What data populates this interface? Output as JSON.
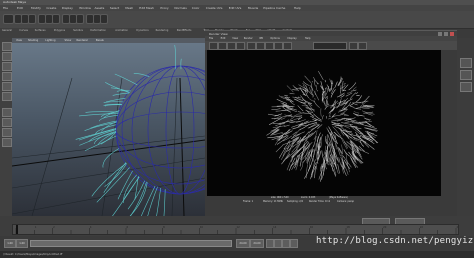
{
  "app": {
    "title": "Autodesk Maya",
    "menus": [
      "File",
      "Edit",
      "Modify",
      "Create",
      "Display",
      "Window",
      "Assets",
      "Select",
      "Mesh",
      "Edit Mesh",
      "Proxy",
      "Normals",
      "Color",
      "Create UVs",
      "Edit UVs",
      "Muscle",
      "Pipeline Cache",
      "Help"
    ]
  },
  "shelf": {
    "tabs": [
      "General",
      "Curves",
      "Surfaces",
      "Polygons",
      "Subdivs",
      "Deformation",
      "Animation",
      "Dynamics",
      "Rendering",
      "PaintEffects",
      "Toon",
      "Muscle",
      "Fluids",
      "Fur",
      "Hair",
      "nCloth",
      "Custom"
    ]
  },
  "viewport": {
    "menus": [
      "View",
      "Shading",
      "Lighting",
      "Show",
      "Renderer",
      "Panels"
    ]
  },
  "render_view": {
    "title": "Render View",
    "menus": [
      "File",
      "Edit",
      "View",
      "Render",
      "IPR",
      "Options",
      "Display",
      "Help"
    ],
    "status": {
      "size": "size: 960 x 540",
      "zoom": "zoom: 0.183",
      "renderer": "(Maya Software)",
      "frame": "Frame: 1",
      "memory": "Memory: 1174Mb",
      "sampling": "Sampling: 2/4",
      "time": "Render Time: 0:11",
      "camera": "Camera: persp"
    }
  },
  "timeline": {
    "ticks": [
      "1",
      "2",
      "4",
      "6",
      "8",
      "10",
      "12",
      "14",
      "16",
      "18",
      "20",
      "22",
      "24"
    ],
    "current_frame": "1.00",
    "end_frame": "24.00"
  },
  "command_line": {
    "text": "// Result: C:/Users/Maya/images/tmp/untitled.iff"
  },
  "watermark": {
    "text": "http://blog.csdn.net/pengyizhe"
  },
  "colors": {
    "background": "#3a3a3a",
    "render_canvas": "#050505",
    "fur": "#c8c8c8",
    "sphere_wire": "#2a2aa0",
    "hair_curves": "#5fd3d3"
  }
}
